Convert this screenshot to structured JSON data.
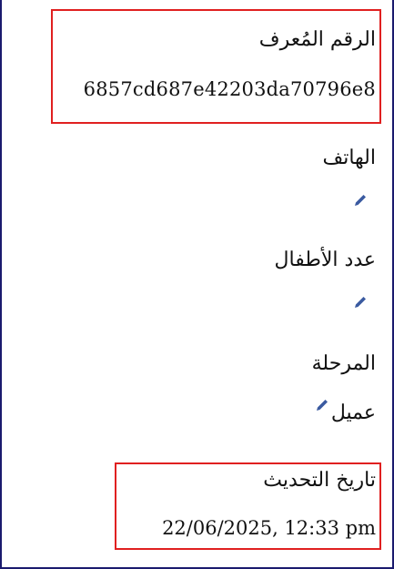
{
  "fields": {
    "id": {
      "label": "الرقم المُعرف",
      "value": "6857cd687e42203da70796e8"
    },
    "phone": {
      "label": "الهاتف",
      "value": ""
    },
    "children_count": {
      "label": "عدد الأطفال",
      "value": ""
    },
    "stage": {
      "label": "المرحلة",
      "value": "عميل"
    },
    "updated_at": {
      "label": "تاريخ التحديث",
      "value": "22/06/2025, 12:33 pm"
    }
  },
  "icons": {
    "edit": "pencil-icon"
  },
  "colors": {
    "highlight": "#e02020",
    "frame_border": "#1a1a6e",
    "edit_icon": "#3a5aa0"
  }
}
